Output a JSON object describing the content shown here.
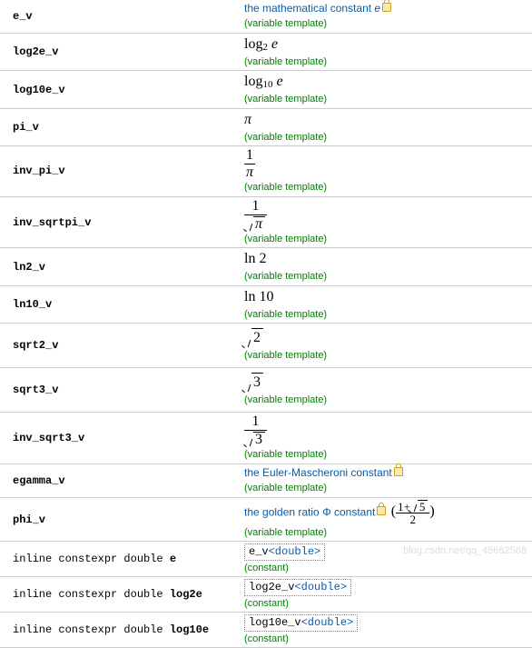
{
  "rows": [
    {
      "name": "e_v",
      "desc_html": "the mathematical constant <i>e</i>",
      "lock": true,
      "cat": "(variable template)"
    },
    {
      "name": "log2e_v",
      "math_html": "log<span class='sub'>2</span> <i>e</i>",
      "cat": "(variable template)"
    },
    {
      "name": "log10e_v",
      "math_html": "log<span class='sub'>10</span> <i>e</i>",
      "cat": "(variable template)"
    },
    {
      "name": "pi_v",
      "math_html": "<i>π</i>",
      "cat": "(variable template)"
    },
    {
      "name": "inv_pi_v",
      "math_html": "<span class='frac'><span class='num'>1</span><span class='den'><i>π</i></span></span>",
      "cat": "(variable template)"
    },
    {
      "name": "inv_sqrtpi_v",
      "math_html": "<span class='frac'><span class='num'>1</span><span class='den'><span class='sqrt'><span class='rad'><i>π</i></span></span></span></span>",
      "cat": "(variable template)"
    },
    {
      "name": "ln2_v",
      "math_html": "ln 2",
      "cat": "(variable template)"
    },
    {
      "name": "ln10_v",
      "math_html": "ln 10",
      "cat": "(variable template)"
    },
    {
      "name": "sqrt2_v",
      "math_html": "<span class='sqrt'><span class='rad'>2</span></span>",
      "cat": "(variable template)"
    },
    {
      "name": "sqrt3_v",
      "math_html": "<span class='sqrt'><span class='rad'>3</span></span>",
      "cat": "(variable template)"
    },
    {
      "name": "inv_sqrt3_v",
      "math_html": "<span class='frac'><span class='num'>1</span><span class='den'><span class='sqrt'><span class='rad'>3</span></span></span></span>",
      "cat": "(variable template)"
    },
    {
      "name": "egamma_v",
      "desc_html": "the Euler-Mascheroni constant",
      "lock": true,
      "cat": "(variable template)"
    },
    {
      "name": "phi_v",
      "desc_html": "the golden ratio Φ constant",
      "lock": true,
      "extra_math_html": "(<span class='frac small'><span class='num'>1+<span class='sqrt inline'><span class='rad'>5</span></span></span><span class='den'>2</span></span>)",
      "cat": "(variable template)"
    }
  ],
  "const_rows": [
    {
      "decl_pre": "inline constexpr double ",
      "decl_name": "e",
      "code_name": "e_v",
      "code_type": "<double>",
      "cat": "(constant)"
    },
    {
      "decl_pre": "inline constexpr double ",
      "decl_name": "log2e",
      "code_name": "log2e_v",
      "code_type": "<double>",
      "cat": "(constant)"
    },
    {
      "decl_pre": "inline constexpr double ",
      "decl_name": "log10e",
      "code_name": "log10e_v",
      "code_type": "<double>",
      "cat": "(constant)"
    }
  ],
  "watermark": "blog.csdn.net/qq_45662588"
}
